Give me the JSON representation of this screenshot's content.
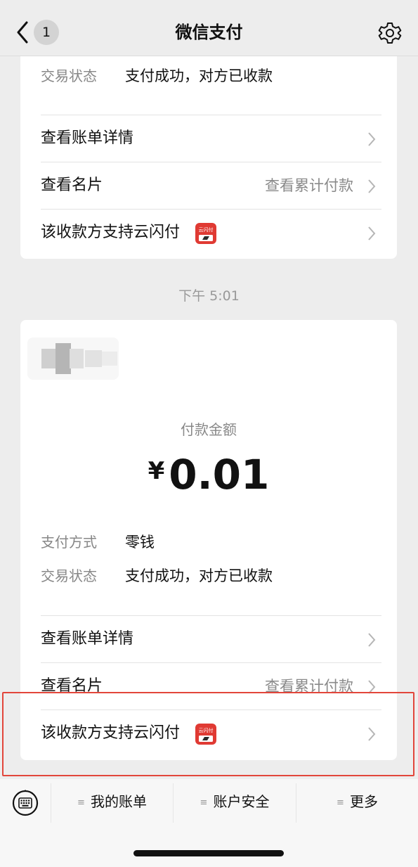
{
  "nav": {
    "badge": "1",
    "title": "微信支付",
    "icons": {
      "back": "chevron-left-icon",
      "settings": "gear-icon"
    }
  },
  "card_top": {
    "status_label": "交易状态",
    "status_value": "支付成功，对方已收款",
    "bill_detail": "查看账单详情",
    "view_card": "查看名片",
    "cumulative": "查看累计付款",
    "yunshanfu": "该收款方支持云闪付"
  },
  "time": "下午 5:01",
  "card_bottom": {
    "amount_label": "付款金额",
    "currency": "¥",
    "amount": "0.01",
    "method_label": "支付方式",
    "method_value": "零钱",
    "status_label": "交易状态",
    "status_value": "支付成功，对方已收款",
    "bill_detail": "查看账单详情",
    "view_card": "查看名片",
    "cumulative": "查看累计付款",
    "yunshanfu": "该收款方支持云闪付"
  },
  "yunshanfu_logo": "云闪付",
  "bottom_menu": {
    "keyboard_icon": "keyboard-icon",
    "items": [
      "我的账单",
      "账户安全",
      "更多"
    ]
  },
  "colors": {
    "background": "#ededed",
    "card": "#ffffff",
    "highlight": "#e2463b",
    "logo_red": "#e03a33"
  }
}
